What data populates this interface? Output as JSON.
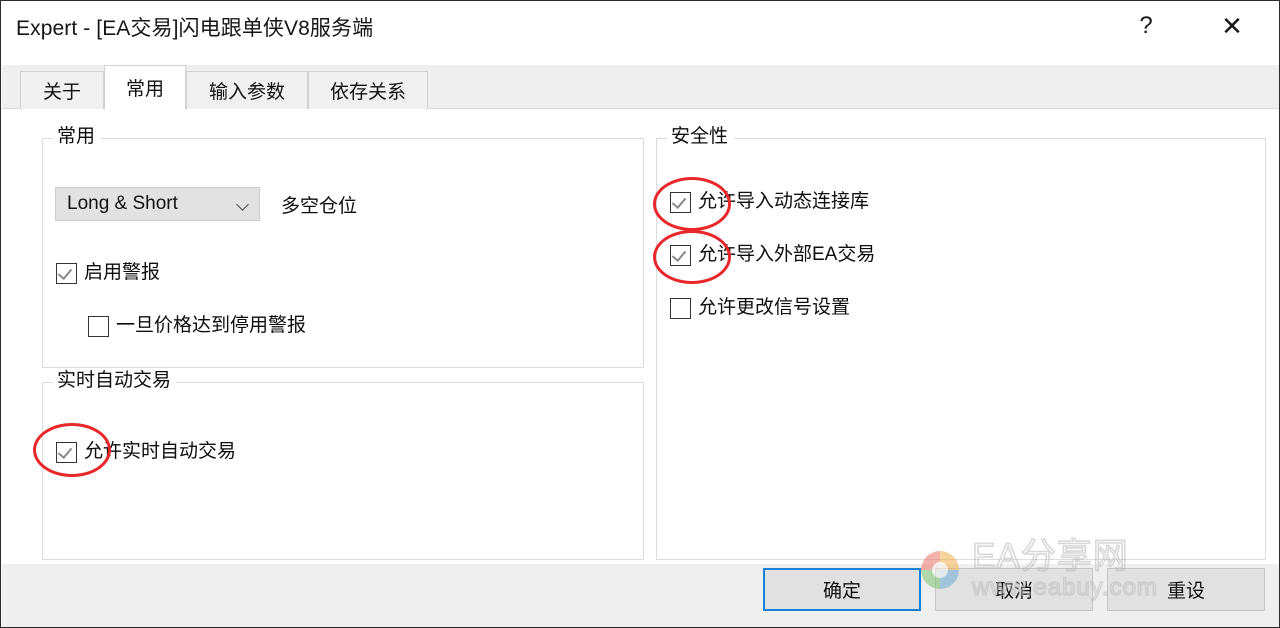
{
  "window": {
    "title": "Expert - [EA交易]闪电跟单侠V8服务端",
    "help_icon": "question-mark-icon",
    "help_label": "?",
    "close_icon": "close-icon",
    "close_label": "✕"
  },
  "tabs": [
    {
      "label": "关于",
      "active": false
    },
    {
      "label": "常用",
      "active": true
    },
    {
      "label": "输入参数",
      "active": false
    },
    {
      "label": "依存关系",
      "active": false
    }
  ],
  "common_group": {
    "legend": "常用",
    "combo": {
      "value": "Long & Short",
      "caption": "多空仓位",
      "chevron_icon": "chevron-down-icon"
    },
    "checkboxes": [
      {
        "label": "启用警报",
        "checked": true
      },
      {
        "label": "一旦价格达到停用警报",
        "checked": false
      }
    ]
  },
  "realtime_group": {
    "legend": "实时自动交易",
    "checkboxes": [
      {
        "label": "允许实时自动交易",
        "checked": true
      }
    ]
  },
  "security_group": {
    "legend": "安全性",
    "checkboxes": [
      {
        "label": "允许导入动态连接库",
        "checked": true
      },
      {
        "label": "允许导入外部EA交易",
        "checked": true
      },
      {
        "label": "允许更改信号设置",
        "checked": false
      }
    ]
  },
  "annotations": {
    "color": "#e8272b",
    "shape": "ellipse",
    "targets": [
      "允许导入动态连接库",
      "允许导入外部EA交易",
      "允许实时自动交易"
    ]
  },
  "footer": {
    "ok_label": "确定",
    "cancel_label": "取消",
    "reset_label": "重设"
  },
  "watermark": {
    "title": "EA分享网",
    "url": "www.eabuy.com",
    "logo_icon": "rainbow-logo-icon"
  }
}
